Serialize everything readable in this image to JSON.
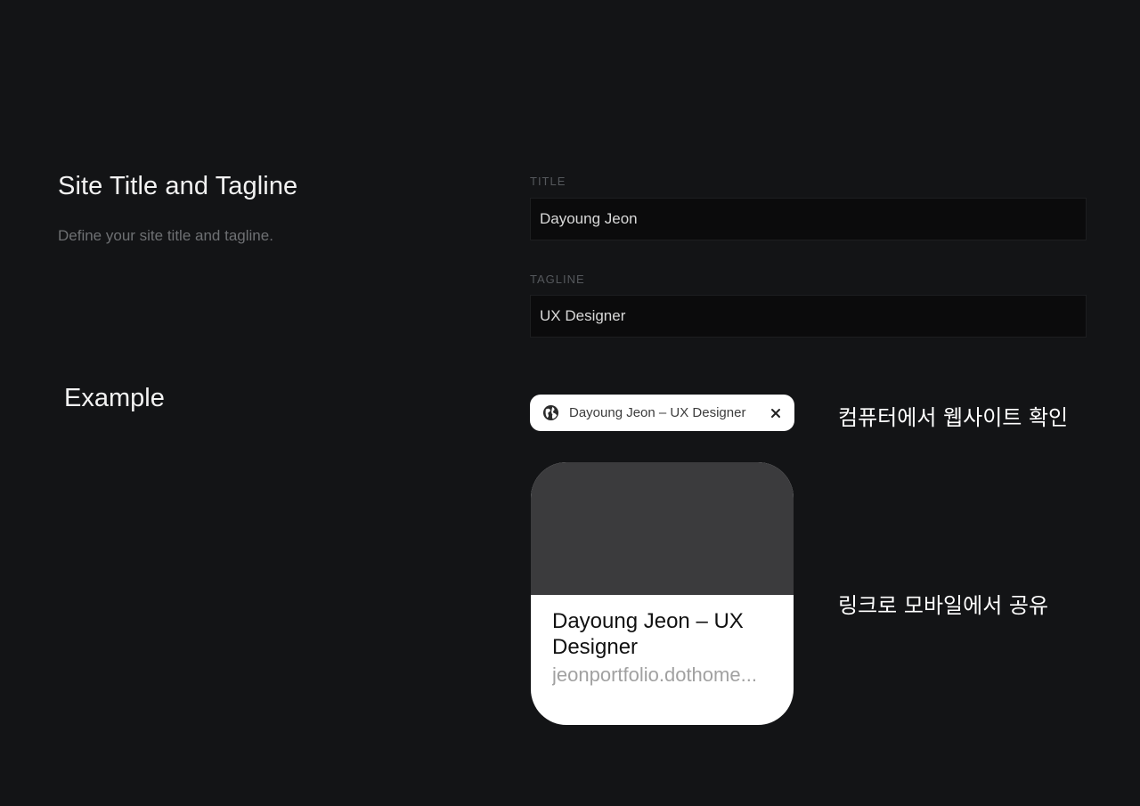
{
  "section": {
    "title": "Site Title and Tagline",
    "description": "Define your site title and tagline."
  },
  "fields": {
    "title": {
      "label": "TITLE",
      "value": "Dayoung Jeon"
    },
    "tagline": {
      "label": "TAGLINE",
      "value": "UX Designer"
    }
  },
  "example": {
    "heading": "Example",
    "browser_tab": {
      "icon": "globe-icon",
      "title": "Dayoung Jeon – UX Designer",
      "close_icon": "close-icon"
    },
    "desktop_caption": "컴퓨터에서 웹사이트 확인",
    "share_card": {
      "title": "Dayoung Jeon – UX Designer",
      "url": "jeonportfolio.dothome..."
    },
    "mobile_caption": "링크로 모바일에서 공유"
  },
  "colors": {
    "background": "#131416",
    "input_background": "#0b0b0c",
    "card_thumbnail": "#3b3b3d"
  }
}
